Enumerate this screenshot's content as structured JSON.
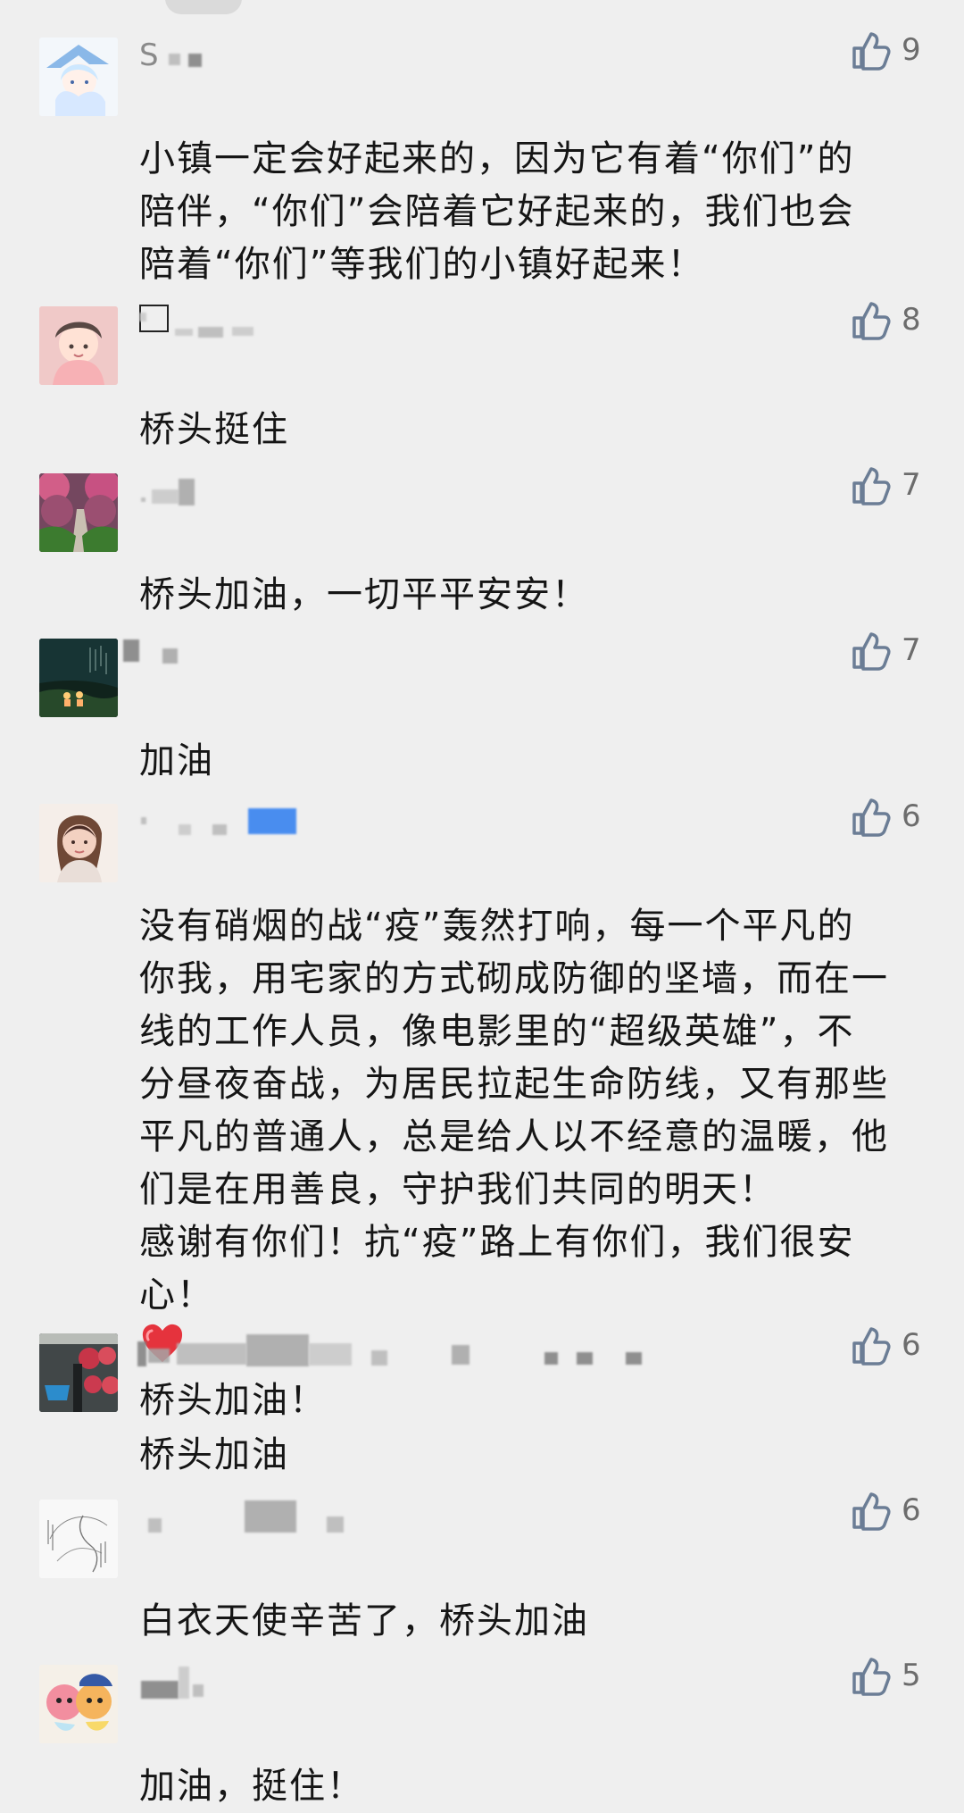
{
  "comments": [
    {
      "username": "S",
      "likes": "9",
      "text_before": "小镇一定会好起来的，因为它有着“你们”的\n陪伴，“你们”会陪着它好起来的，我们也会\n陪着“你们”等我们的小镇好起来！",
      "text_after": ""
    },
    {
      "username": "",
      "likes": "8",
      "text_before": "桥头挺住",
      "text_after": ""
    },
    {
      "username": "",
      "likes": "7",
      "text_before": "桥头加油，一切平平安安！",
      "text_after": ""
    },
    {
      "username": "",
      "likes": "7",
      "text_before": "加油",
      "text_after": ""
    },
    {
      "username": "",
      "likes": "6",
      "text_before": "没有硝烟的战“疫”轰然打响，每一个平凡的\n你我，用宅家的方式砌成防御的坚墙，而在一\n线的工作人员，像电影里的“超级英雄”，不\n分昼夜奋战，为居民拉起生命防线，又有那些\n平凡的普通人，总是给人以不经意的温暖，他\n们是在用善良，守护我们共同的明天！\n感谢有你们！抗“疫”路上有你们，我们很安\n心！",
      "text_after": "桥头加油！"
    },
    {
      "username": "",
      "likes": "6",
      "text_before": "桥头加油",
      "text_after": ""
    },
    {
      "username": "",
      "likes": "6",
      "text_before": "白衣天使辛苦了，桥头加油",
      "text_after": ""
    },
    {
      "username": "",
      "likes": "5",
      "text_before": "加油，挺住！",
      "text_after": ""
    }
  ],
  "colors": {
    "background": "#efefef",
    "text": "#151515",
    "muted": "#8a8a8a",
    "like": "#707070",
    "heart": "#e5333d"
  },
  "icons": {
    "like": "thumbs-up-icon",
    "heart": "heart-emoji-icon",
    "unknown_character": "box-glyph"
  }
}
